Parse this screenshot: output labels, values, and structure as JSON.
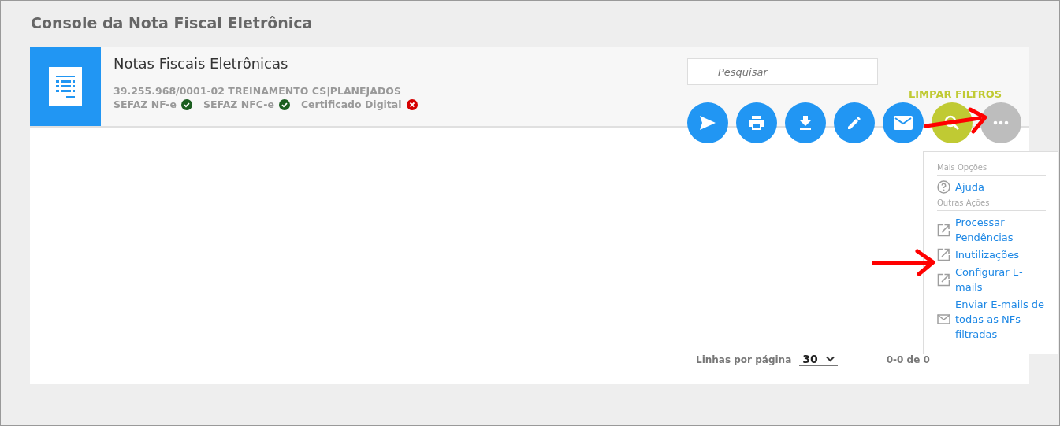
{
  "page_title": "Console da Nota Fiscal Eletrônica",
  "header": {
    "title": "Notas Fiscais Eletrônicas",
    "company": "39.255.968/0001-02 TREINAMENTO CS|PLANEJADOS",
    "statuses": [
      {
        "label": "SEFAZ NF-e",
        "ok": true
      },
      {
        "label": "SEFAZ NFC-e",
        "ok": true
      },
      {
        "label": "Certificado Digital",
        "ok": false
      }
    ]
  },
  "search": {
    "placeholder": "Pesquisar"
  },
  "clear_filters": "LIMPAR FILTROS",
  "actions": [
    {
      "kind": "send"
    },
    {
      "kind": "print"
    },
    {
      "kind": "download"
    },
    {
      "kind": "edit"
    },
    {
      "kind": "mail"
    },
    {
      "kind": "search"
    },
    {
      "kind": "more"
    }
  ],
  "menu": [
    {
      "kind": "section",
      "label": "Mais Opções"
    },
    {
      "kind": "help",
      "label": "Ajuda"
    },
    {
      "kind": "section",
      "label": "Outras Ações"
    },
    {
      "kind": "external",
      "label": "Processar Pendências"
    },
    {
      "kind": "external",
      "label": "Inutilizações"
    },
    {
      "kind": "external",
      "label": "Configurar E-mails"
    },
    {
      "kind": "mail",
      "label": "Enviar E-mails de todas as NFs filtradas"
    }
  ],
  "pagination": {
    "rows_label": "Linhas por página",
    "rows_value": "30",
    "range": "0-0 de 0"
  }
}
